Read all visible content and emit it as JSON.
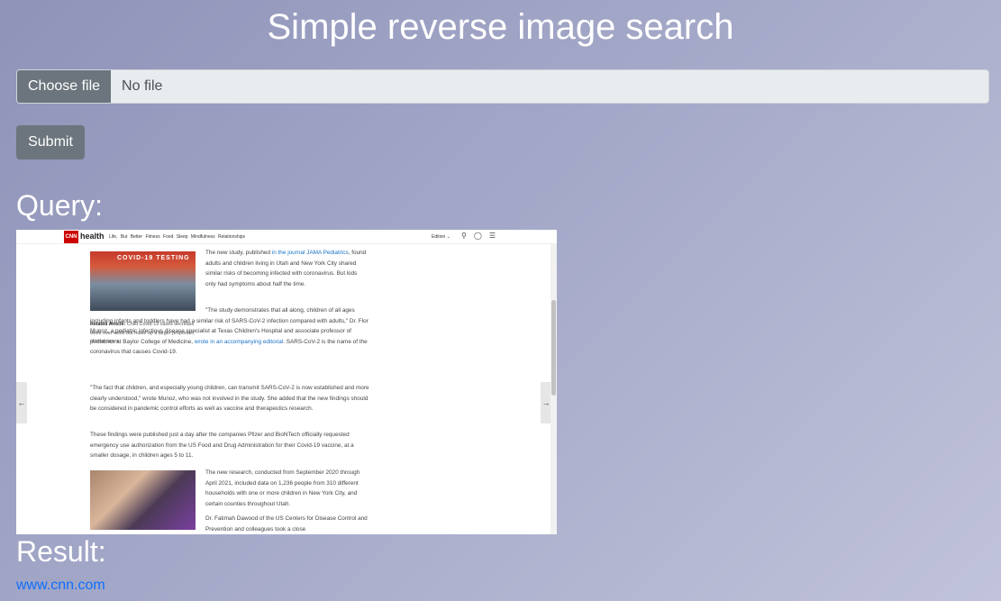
{
  "header": {
    "title": "Simple reverse image search"
  },
  "upload": {
    "choose_file_label": "Choose file",
    "file_status": "No file",
    "submit_label": "Submit"
  },
  "query": {
    "label": "Query:",
    "image": {
      "nav": {
        "logo_mark": "CNN",
        "logo_text": "health",
        "links": "Life, But Better  Fitness  Food  Sleep  Mindfulness  Relationships",
        "edition": "Edition ⌄"
      },
      "photo1_banner": "COVID-19 TESTING",
      "p1_a": "The new study, published ",
      "p1_link": "in the journal JAMA Pediatrics",
      "p1_b": ", found adults and children living in Utah and New York City shared similar risks of becoming infected with coronavirus. But kids only had symptoms about half the time.",
      "related_label": "Related Article:",
      "related_text": " Child Covid-19 cases decrease week over week but make up a larger proportion of total cases",
      "p2_a": "\"The study demonstrates that all along, children of all ages including infants and toddlers have had a similar risk of SARS-CoV-2 infection compared with adults,\" Dr. Flor Munoz, a pediatric infectious disease specialist at Texas Children's Hospital and associate professor of pediatrics at Baylor College of Medicine, ",
      "p2_link": "wrote in an accompanying editorial",
      "p2_b": ". SARS-CoV-2 is the name of the coronavirus that causes Covid-19.",
      "p3": "\"The fact that children, and especially young children, can transmit SARS-CoV-2 is now established and more clearly understood,\" wrote Munoz, who was not involved in the study. She added that the new findings should be considered in pandemic control efforts as well as vaccine and therapeutics research.",
      "p4": "These findings were published just a day after the companies Pfizer and BioNTech officially requested emergency use authorization from the US Food and Drug Administration for their Covid-19 vaccine, at a smaller dosage, in children ages 5 to 11.",
      "p5": "The new research, conducted from September 2020 through April 2021, included data on 1,236 people from 310 different households with one or more children in New York City, and certain counties throughout Utah.",
      "p6": "Dr. Fatimah Dawood of the US Centers for Disease Control and Prevention and colleagues took a close"
    }
  },
  "result": {
    "label": "Result:",
    "link_text": "www.cnn.com"
  }
}
